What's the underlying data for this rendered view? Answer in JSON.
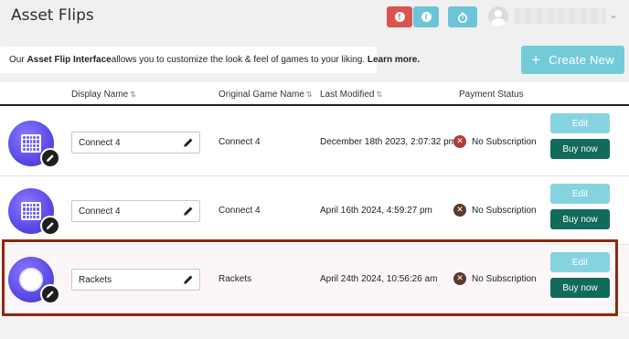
{
  "header": {
    "title": "Asset Flips",
    "alert_icon": "alert-icon",
    "info_icon": "info-icon",
    "timer_icon": "timer-icon",
    "username": ""
  },
  "info": {
    "prefix": "Our ",
    "bold1": "Asset Flip Interface",
    "middle": " allows you to customize the look & feel of games to your liking. ",
    "bold2": "Learn more."
  },
  "create_button": {
    "plus": "+",
    "label": "Create New"
  },
  "table": {
    "columns": [
      "Display Name",
      "Original Game Name",
      "Last Modified",
      "Payment Status"
    ],
    "rows": [
      {
        "display_name": "Connect 4",
        "original": "Connect 4",
        "modified": "December 18th 2023, 2:07:32 pm",
        "status": "No Subscription",
        "edit": "Edit",
        "buy": "Buy now"
      },
      {
        "display_name": "Connect 4",
        "original": "Connect 4",
        "modified": "April 16th 2024, 4:59:27 pm",
        "status": "No Subscription",
        "edit": "Edit",
        "buy": "Buy now"
      },
      {
        "display_name": "Rackets",
        "original": "Rackets",
        "modified": "April 24th 2024, 10:56:26 am",
        "status": "No Subscription",
        "edit": "Edit",
        "buy": "Buy now"
      }
    ]
  },
  "colors": {
    "accent": "#73cbd9",
    "buy": "#116b5a",
    "danger": "#d9534f",
    "highlight": "#8a2a10"
  }
}
